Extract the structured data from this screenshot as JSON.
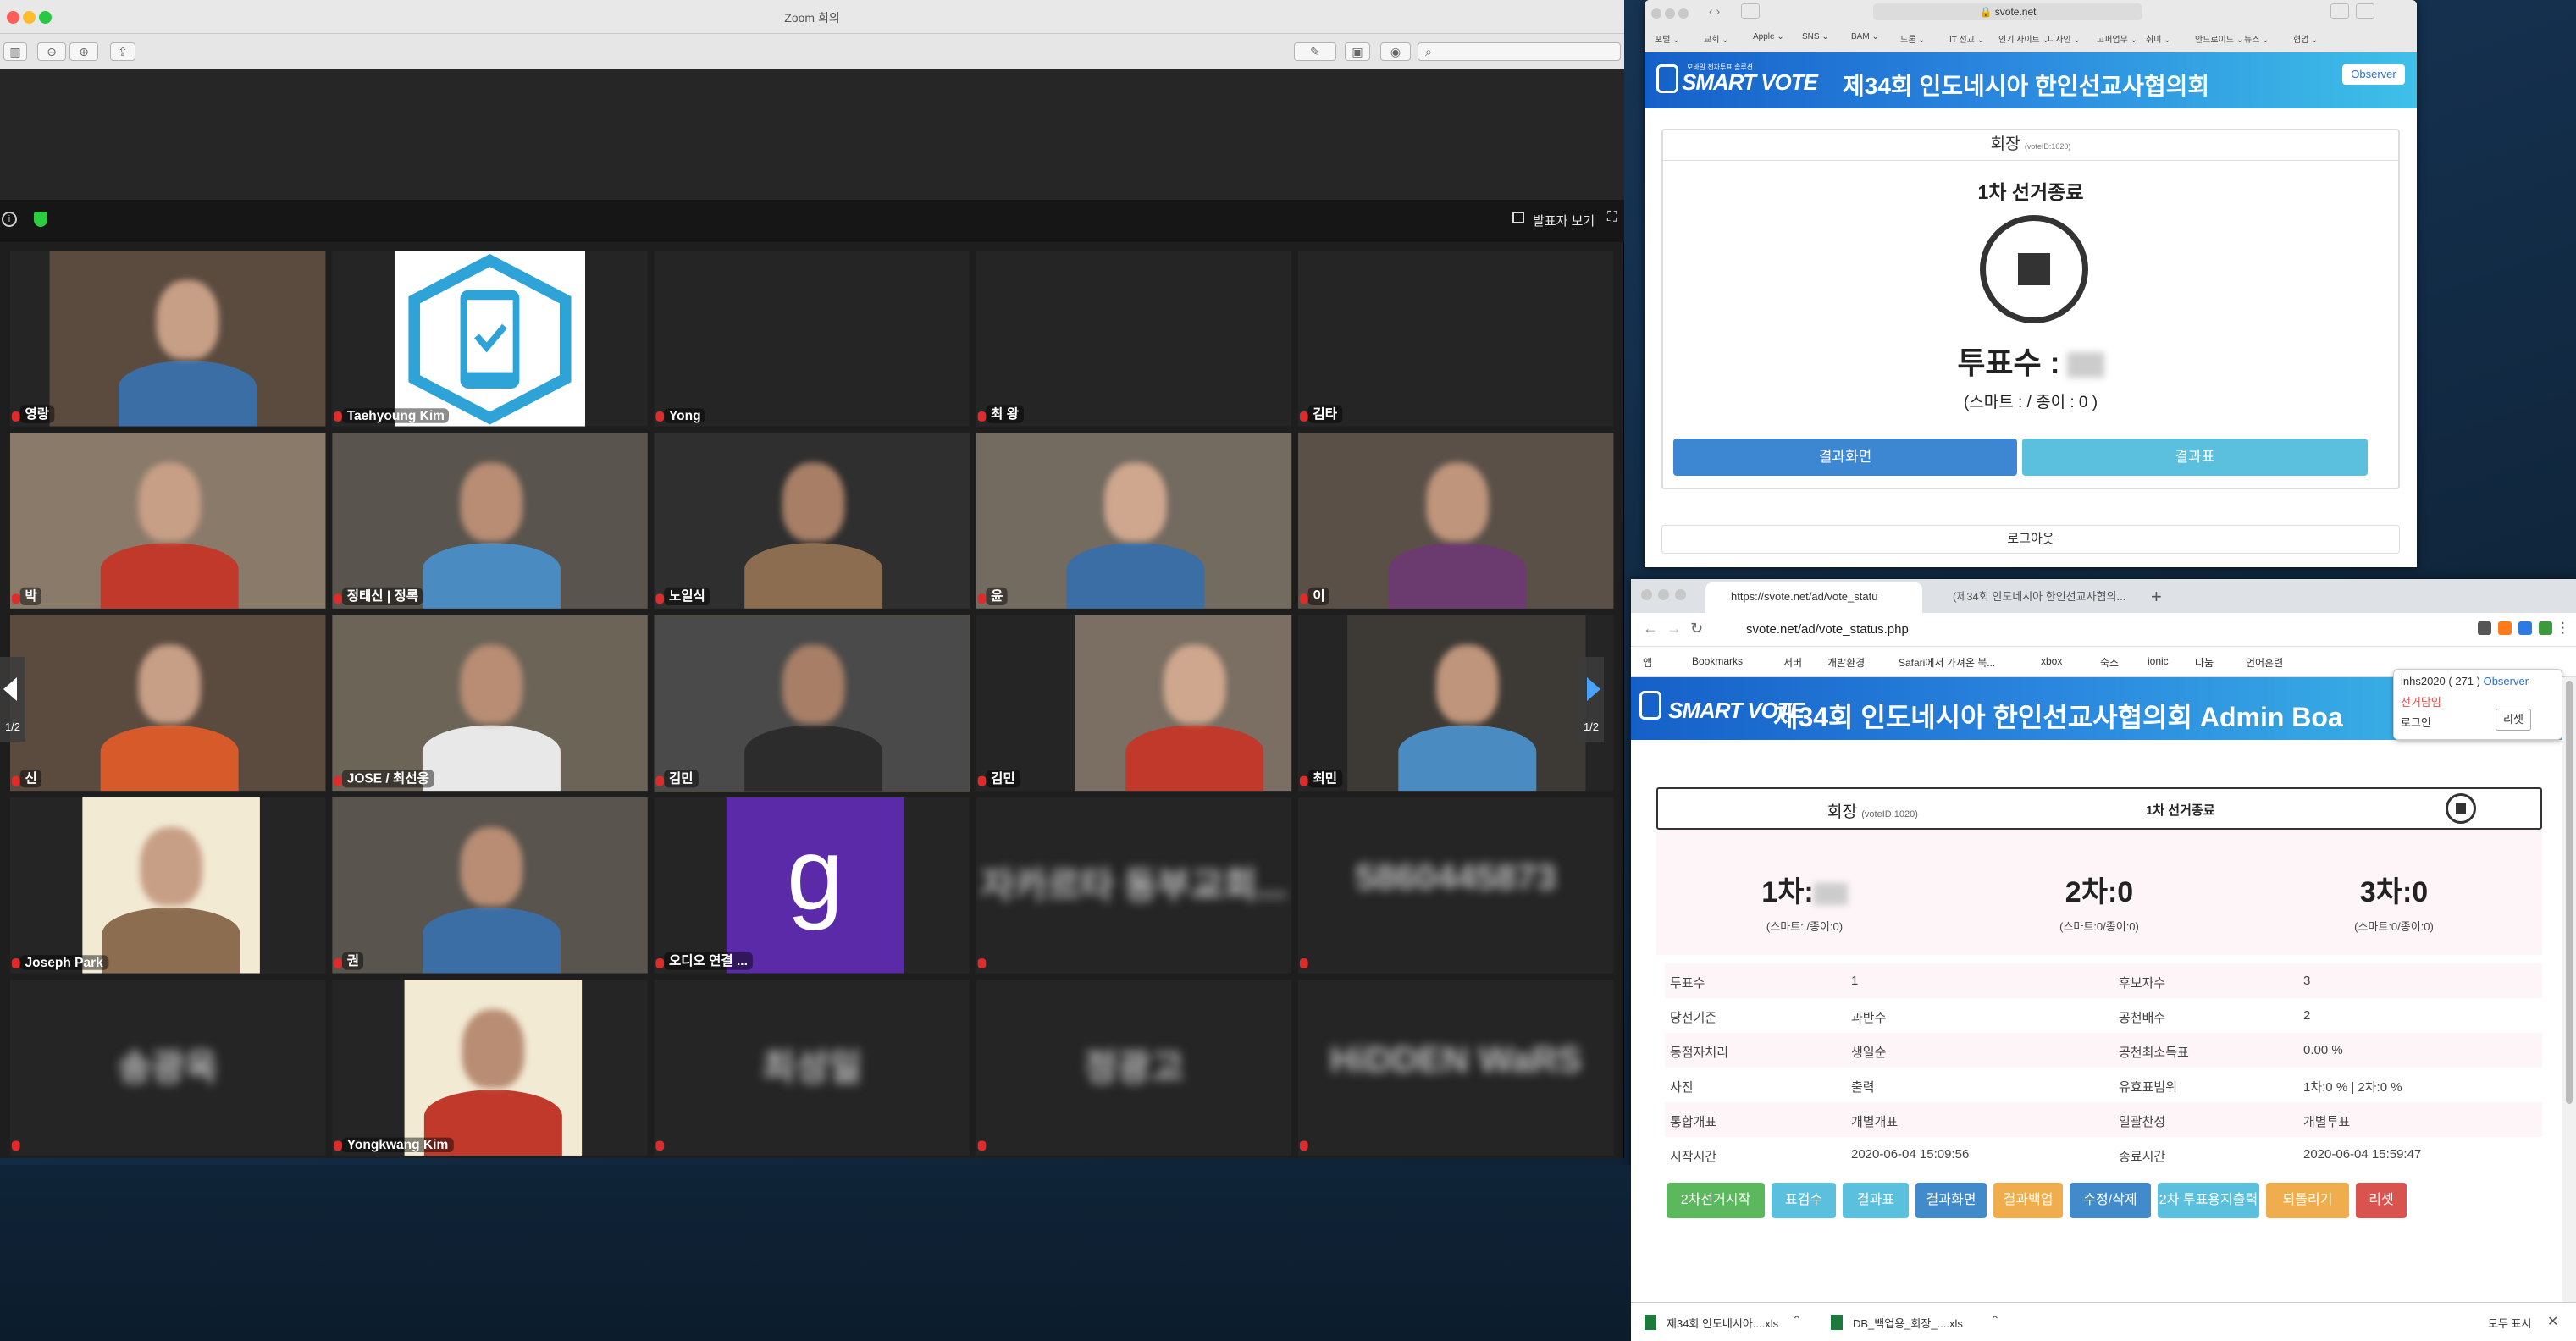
{
  "zoom": {
    "title": "Zoom 회의",
    "speaker_view_label": "발표자 보기",
    "page_indicator": "1/2",
    "participants": [
      {
        "name": "영랑 "
      },
      {
        "name": "Taehyoung Kim"
      },
      {
        "name": "Yong"
      },
      {
        "name": "최 왕"
      },
      {
        "name": "김타"
      },
      {
        "name": "박"
      },
      {
        "name": "정태신 | 정록"
      },
      {
        "name": "노일식"
      },
      {
        "name": "윤"
      },
      {
        "name": "이"
      },
      {
        "name": "신"
      },
      {
        "name": "JOSE / 최선웅"
      },
      {
        "name": "김민"
      },
      {
        "name": "김민"
      },
      {
        "name": "최민"
      },
      {
        "name": "Joseph Park"
      },
      {
        "name": "권"
      },
      {
        "name": "오디오 연결 ..."
      },
      {
        "name": "",
        "big": "자카르타 동부교회..."
      },
      {
        "name": "",
        "big": "5860445873"
      },
      {
        "name": "",
        "big": "송광옥"
      },
      {
        "name": "Yongkwang Kim"
      },
      {
        "name": "",
        "big": "최성일"
      },
      {
        "name": "",
        "big": "정광고"
      },
      {
        "name": "",
        "big": "HiDDEN WaRS"
      }
    ],
    "avatar_letter": "g"
  },
  "safari": {
    "url": "svote.net",
    "bookmarks": [
      "포털 ⌄",
      "교회 ⌄",
      "Apple ⌄",
      "SNS ⌄",
      "BAM ⌄",
      "드론 ⌄",
      "IT 선교 ⌄",
      "인기 사이트 ⌄",
      "디자인 ⌄",
      "고퍼업무 ⌄",
      "취미 ⌄",
      "안드로이드 ⌄",
      "뉴스 ⌄",
      "협업 ⌄"
    ],
    "logo_sub": "모바일 전자투표 솔루션",
    "logo": "SMART VOTE",
    "title": "제34회 인도네시아 한인선교사협의회",
    "observer_btn": "Observer",
    "card_title": "회장",
    "vote_id": "(voteID:1020)",
    "status": "1차 선거종료",
    "count_label": "투표수 :",
    "count_detail": "(스마트 :    / 종이 : 0 )",
    "btn_result_screen": "결과화면",
    "btn_result_table": "결과표",
    "logout": "로그아웃"
  },
  "chrome": {
    "tabs": [
      "https://svote.net/ad/vote_statu",
      "(제34회 인도네시아 한인선교사협의..."
    ],
    "url": "svote.net/ad/vote_status.php",
    "bookmarks": [
      "앱",
      "Bookmarks",
      "서버",
      "개발환경",
      "Safari에서 가져온 북...",
      "xbox",
      "숙소",
      "ionic",
      "나눔",
      "언어훈련"
    ],
    "header_title": "제34회 인도네시아 한인선교사협의회 Admin Boa",
    "user_info": "inhs2020 ( 271 )",
    "user_role": "Observer",
    "user_sub1": "선거담임",
    "user_sub2": "로그인",
    "reset_btn": "리셋",
    "card_title": "회장",
    "vote_id": "(voteID:1020)",
    "status": "1차 선거종료",
    "rounds": [
      {
        "label": "1차:",
        "value": "",
        "detail": "(스마트:    /종이:0)"
      },
      {
        "label": "2차:0",
        "value": "",
        "detail": "(스마트:0/종이:0)"
      },
      {
        "label": "3차:0",
        "value": "",
        "detail": "(스마트:0/종이:0)"
      }
    ],
    "rows": [
      [
        "투표수",
        "1",
        "후보자수",
        "3"
      ],
      [
        "당선기준",
        "과반수",
        "공천배수",
        "2"
      ],
      [
        "동점자처리",
        "생일순",
        "공천최소득표",
        "0.00 %"
      ],
      [
        "사진",
        "출력",
        "유효표범위",
        "1차:0 % | 2차:0 %"
      ],
      [
        "통합개표",
        "개별개표",
        "일괄찬성",
        "개별투표"
      ],
      [
        "시작시간",
        "2020-06-04 15:09:56",
        "종료시간",
        "2020-06-04 15:59:47"
      ]
    ],
    "buttons": [
      {
        "label": "2차선거시작",
        "color": "#5cb85c"
      },
      {
        "label": "표검수",
        "color": "#5bc0de"
      },
      {
        "label": "결과표",
        "color": "#5bc0de"
      },
      {
        "label": "결과화면",
        "color": "#428bca"
      },
      {
        "label": "결과백업",
        "color": "#f0ad4e"
      },
      {
        "label": "수정/삭제",
        "color": "#428bca"
      },
      {
        "label": "2차 투표용지출력",
        "color": "#5bc0de"
      },
      {
        "label": "되돌리기",
        "color": "#f0ad4e"
      },
      {
        "label": "리셋",
        "color": "#d9534f"
      }
    ],
    "downloads": [
      "제34회 인도네시아....xls",
      "DB_백업용_회장_....xls"
    ],
    "show_all": "모두 표시"
  }
}
